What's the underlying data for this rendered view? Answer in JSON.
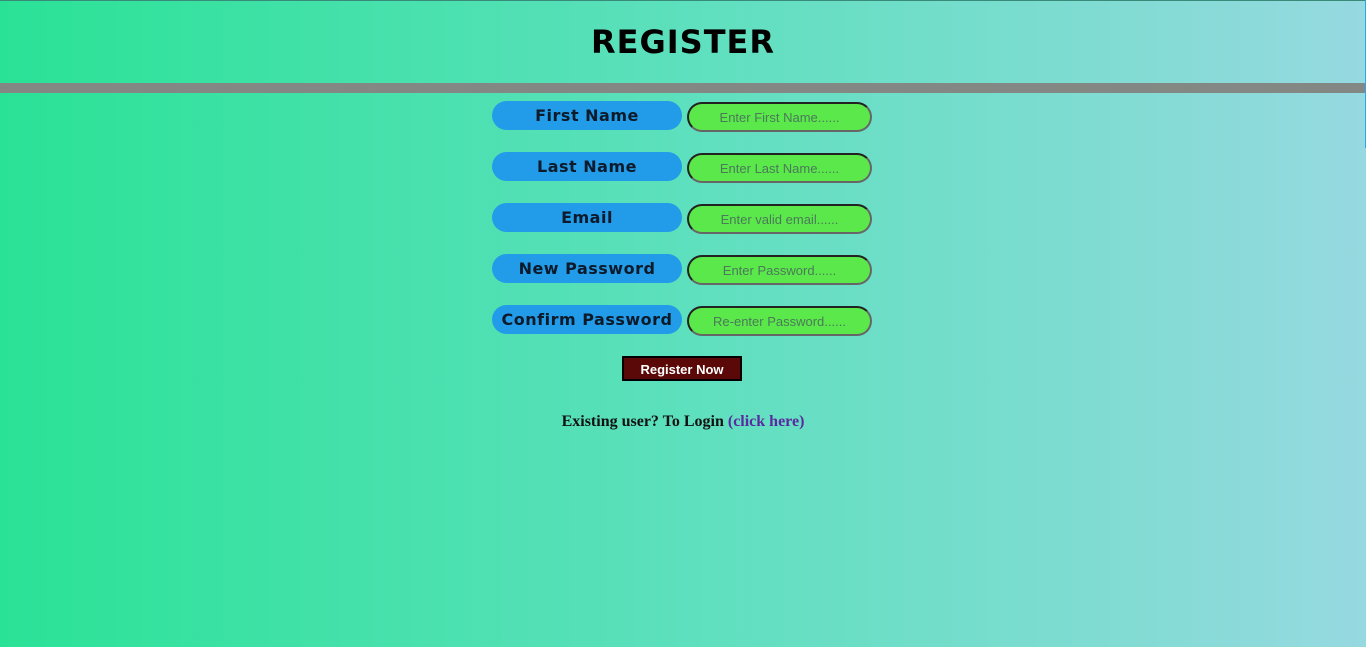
{
  "header": {
    "title": "REGISTER"
  },
  "form": {
    "fields": [
      {
        "label": "First Name",
        "placeholder": "Enter First Name......"
      },
      {
        "label": "Last Name",
        "placeholder": "Enter Last Name......"
      },
      {
        "label": "Email",
        "placeholder": "Enter valid email......"
      },
      {
        "label": "New Password",
        "placeholder": "Enter Password......"
      },
      {
        "label": "Confirm Password",
        "placeholder": "Re-enter Password......"
      }
    ],
    "submit_label": "Register Now"
  },
  "footer": {
    "prompt": "Existing user? To Login ",
    "link_text": "(click here)"
  },
  "colors": {
    "label_bg": "#229be8",
    "input_bg": "#5be84a",
    "button_bg": "#5a0808",
    "divider": "#848884",
    "link": "#5a2aa0"
  }
}
